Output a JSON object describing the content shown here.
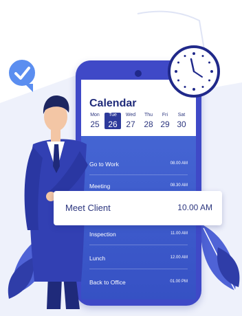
{
  "calendar": {
    "title": "Calendar",
    "days": [
      {
        "name": "Mon",
        "num": "25",
        "selected": false
      },
      {
        "name": "Tue",
        "num": "26",
        "selected": true
      },
      {
        "name": "Wed",
        "num": "27",
        "selected": false
      },
      {
        "name": "Thu",
        "num": "28",
        "selected": false
      },
      {
        "name": "Fri",
        "num": "29",
        "selected": false
      },
      {
        "name": "Sat",
        "num": "30",
        "selected": false
      }
    ]
  },
  "events": [
    {
      "name": "Go to Work",
      "time": "08.00 AM"
    },
    {
      "name": "Meeting",
      "time": "08.30 AM"
    },
    {
      "name": "Inspection",
      "time": "11.00 AM"
    },
    {
      "name": "Lunch",
      "time": "12.00 AM"
    },
    {
      "name": "Back to Office",
      "time": "01.00 PM"
    }
  ],
  "highlight": {
    "name": "Meet Client",
    "time": "10.00 AM"
  },
  "icons": {
    "clock": "clock-icon",
    "check": "check-bubble-icon"
  },
  "colors": {
    "primary": "#3f49c7",
    "dark": "#20298a",
    "accent": "#5b8ef0",
    "text": "#2b357e"
  }
}
